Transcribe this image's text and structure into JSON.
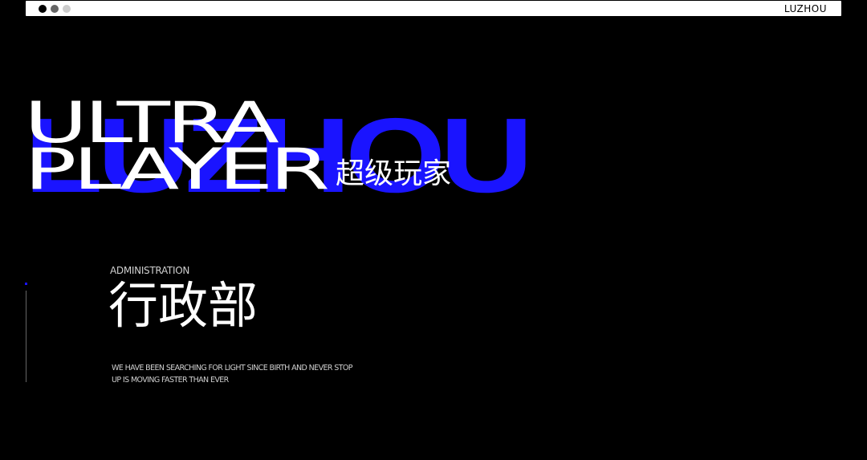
{
  "window": {
    "controls": [
      "close",
      "minimize",
      "maximize"
    ],
    "brand": "LUZHOU"
  },
  "hero": {
    "background_word": "LUZHOU",
    "title_line1": "ULTRA",
    "title_line2": "PLAYER",
    "title_cn": "超级玩家"
  },
  "section": {
    "label_en": "ADMINISTRATION",
    "title_cn": "行政部",
    "description_line1": "WE HAVE BEEN SEARCHING FOR LIGHT SINCE BIRTH AND NEVER STOP",
    "description_line2": "UP IS MOVING FASTER THAN EVER"
  },
  "colors": {
    "background": "#000000",
    "accent": "#1a14ff",
    "text": "#ffffff",
    "muted": "#cfcfcf"
  }
}
